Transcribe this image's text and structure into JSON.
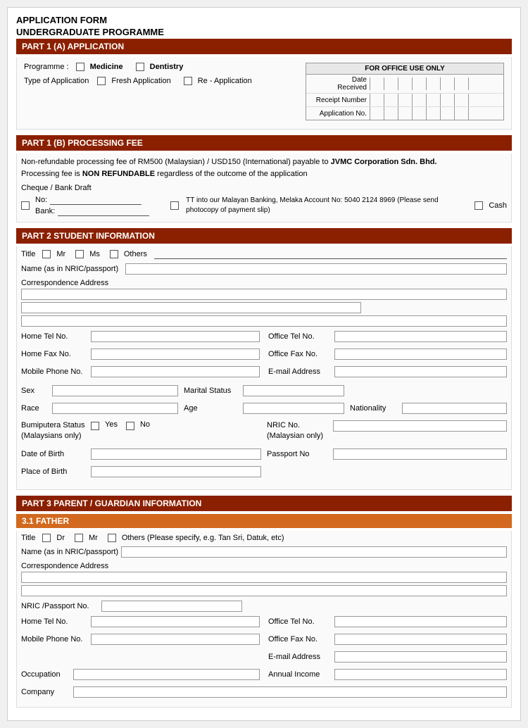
{
  "page": {
    "title": "APPLICATION FORM",
    "subtitle": "UNDERGRADUATE PROGRAMME"
  },
  "part1a": {
    "header": "PART 1 (A)     APPLICATION",
    "programme_label": "Programme :",
    "programme_options": [
      "Medicine",
      "Dentistry"
    ],
    "type_of_application_label": "Type of Application",
    "application_options": [
      "Fresh Application",
      "Re - Application"
    ],
    "office_use": {
      "title": "FOR OFFICE USE ONLY",
      "rows": [
        {
          "label": "Date Received",
          "cells": 8
        },
        {
          "label": "Receipt Number",
          "cells": 8
        },
        {
          "label": "Application No.",
          "cells": 8
        }
      ]
    }
  },
  "part1b": {
    "header": "PART 1 (B)     PROCESSING FEE",
    "fee_text_1": "Non-refundable processing fee of RM500 (Malaysian) / USD150 (International) payable to ",
    "fee_bold": "JVMC Corporation Sdn. Bhd.",
    "fee_text_2": "Processing fee is ",
    "fee_bold2": "NON REFUNDABLE",
    "fee_text_3": " regardless of the outcome of the application",
    "cheque_label": "Cheque / Bank Draft",
    "no_label": "No:",
    "bank_label": "Bank:",
    "tt_text": "TT into our Malayan Banking, Melaka Account No:\n5040 2124 8969  (Please send photocopy of payment slip)",
    "cash_label": "Cash"
  },
  "part2": {
    "header": "PART 2     STUDENT INFORMATION",
    "title_label": "Title",
    "title_options": [
      "Mr",
      "Ms",
      "Others"
    ],
    "name_label": "Name (as in NRIC/passport)",
    "correspondence_label": "Correspondence Address",
    "home_tel_label": "Home Tel No.",
    "office_tel_label": "Office Tel No.",
    "home_fax_label": "Home Fax No.",
    "office_fax_label": "Office Fax No.",
    "mobile_label": "Mobile Phone No.",
    "email_label": "E-mail Address",
    "sex_label": "Sex",
    "marital_label": "Marital Status",
    "race_label": "Race",
    "age_label": "Age",
    "nationality_label": "Nationality",
    "bumi_label": "Bumiputera Status\n(Malaysians only)",
    "bumi_options": [
      "Yes",
      "No"
    ],
    "dob_label": "Date of Birth",
    "nric_label": "NRIC No.\n(Malaysian only)",
    "pob_label": "Place of Birth",
    "passport_label": "Passport No"
  },
  "part3": {
    "header": "PART 3     PARENT / GUARDIAN INFORMATION",
    "sub_header": "3.1     FATHER",
    "title_label": "Title",
    "title_options": [
      "Dr",
      "Mr"
    ],
    "others_label": "Others (Please specify, e.g. Tan Sri, Datuk, etc)",
    "name_label": "Name (as in NRIC/passport)",
    "correspondence_label": "Correspondence Address",
    "nric_label": "NRIC /Passport No.",
    "home_tel_label": "Home Tel No.",
    "office_tel_label": "Office Tel No.",
    "office_fax_label": "Office Fax No.",
    "mobile_label": "Mobile Phone No.",
    "email_label": "E-mail Address",
    "occupation_label": "Occupation",
    "annual_income_label": "Annual Income",
    "company_label": "Company"
  }
}
